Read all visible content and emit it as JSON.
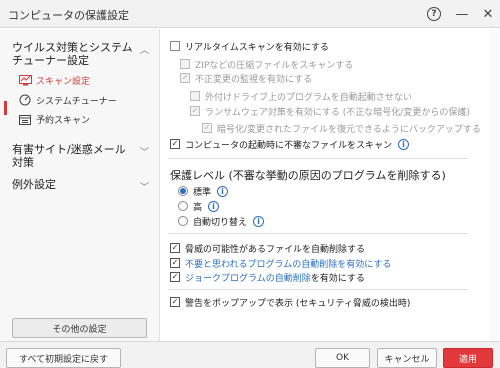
{
  "window": {
    "title": "コンピュータの保護設定",
    "help_glyph": "?"
  },
  "sidebar": {
    "categories": [
      {
        "label": "ウイルス対策とシステム\nチューナー設定"
      },
      {
        "label": "有害サイト/迷惑メール\n対策"
      },
      {
        "label": "例外設定"
      }
    ],
    "items": [
      {
        "label": "スキャン設定",
        "active": true
      },
      {
        "label": "システムチューナー"
      },
      {
        "label": "予約スキャン"
      }
    ],
    "other_button": "その他の設定"
  },
  "settings": {
    "realtime": {
      "label": "リアルタイムスキャンを有効にする",
      "checked": false
    },
    "zip": {
      "label": "ZIPなどの圧縮ファイルをスキャンする",
      "checked": false,
      "disabled": true
    },
    "unauth": {
      "label": "不正変更の監視を有効にする",
      "checked": true,
      "disabled": true
    },
    "external": {
      "label": "外付けドライブ上のプログラムを自動起動させない",
      "checked": false,
      "disabled": true
    },
    "ransom": {
      "label": "ランサムウェア対策を有効にする (不正な暗号化/変更からの保護)",
      "checked": true,
      "disabled": true
    },
    "backup": {
      "label": "暗号化/変更されたファイルを復元できるようにバックアップする",
      "checked": true,
      "disabled": true
    },
    "startup": {
      "label": "コンピュータの起動時に不審なファイルをスキャン",
      "checked": true
    }
  },
  "protection": {
    "title": "保護レベル (不審な挙動の原因のプログラムを削除する)",
    "options": [
      {
        "label": "標準",
        "selected": true
      },
      {
        "label": "高",
        "selected": false
      },
      {
        "label": "自動切り替え",
        "selected": false
      }
    ]
  },
  "threats": {
    "auto_delete": {
      "label": "脅威の可能性があるファイルを自動削除する",
      "checked": true
    },
    "unwanted": {
      "label": "不要と思われるプログラムの自動削除を有効にする",
      "checked": true,
      "link": true
    },
    "joke": {
      "label_link": "ジョークプログラムの自動削除",
      "label_rest": "を有効にする",
      "checked": true
    }
  },
  "popup": {
    "label": "警告をポップアップで表示 (セキュリティ脅威の検出時)",
    "checked": true
  },
  "footer": {
    "reset": "すべて初期設定に戻す",
    "ok": "OK",
    "cancel": "キャンセル",
    "apply": "適用"
  },
  "colors": {
    "accent": "#d23b3b",
    "link": "#2a6fc4",
    "apply": "#e3383b"
  }
}
